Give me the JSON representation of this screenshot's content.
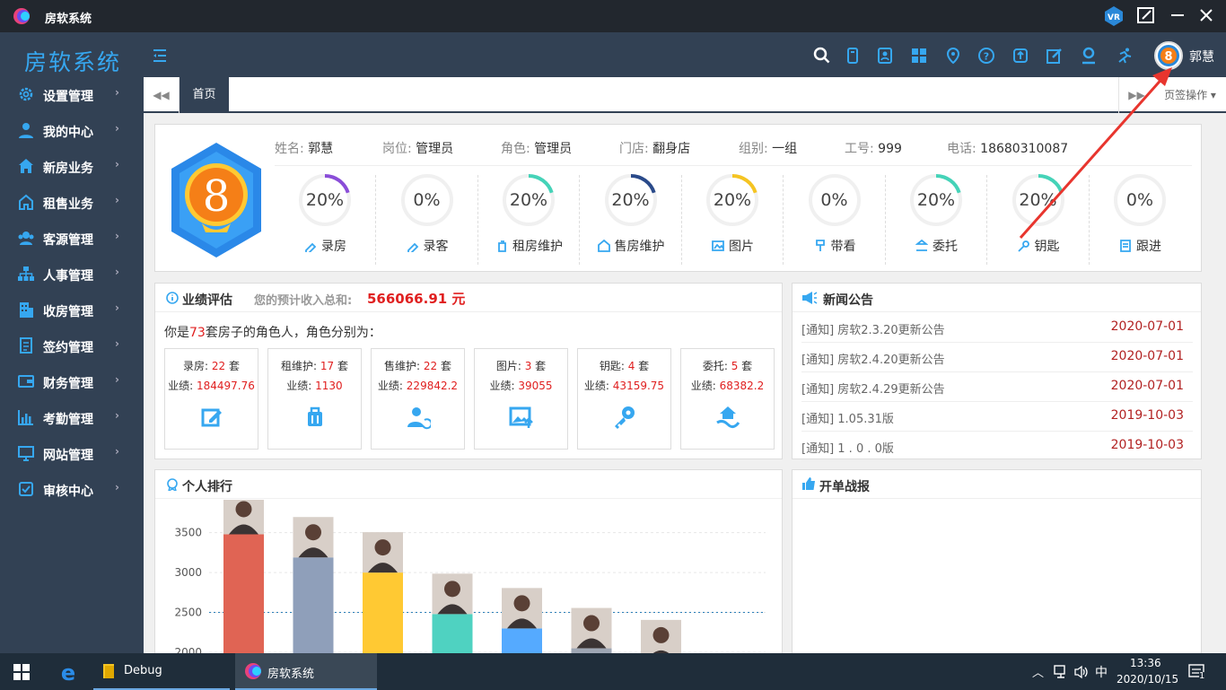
{
  "window": {
    "title": "房软系统"
  },
  "topbar": {
    "brand": "房软系统",
    "username": "郭慧",
    "avatar_digit": "8"
  },
  "sidebar": {
    "items": [
      {
        "label": "设置管理",
        "icon": "gear-icon"
      },
      {
        "label": "我的中心",
        "icon": "user-icon"
      },
      {
        "label": "新房业务",
        "icon": "house-icon"
      },
      {
        "label": "租售业务",
        "icon": "home-outline-icon"
      },
      {
        "label": "客源管理",
        "icon": "customers-icon"
      },
      {
        "label": "人事管理",
        "icon": "org-chart-icon"
      },
      {
        "label": "收房管理",
        "icon": "building-icon"
      },
      {
        "label": "签约管理",
        "icon": "contract-icon"
      },
      {
        "label": "财务管理",
        "icon": "wallet-icon"
      },
      {
        "label": "考勤管理",
        "icon": "bar-chart-icon"
      },
      {
        "label": "网站管理",
        "icon": "monitor-icon"
      },
      {
        "label": "审核中心",
        "icon": "check-icon"
      }
    ]
  },
  "tabs": {
    "home": "首页",
    "ops": "页签操作"
  },
  "profile": {
    "avatar_digit": "8",
    "fields": [
      {
        "key": "姓名:",
        "value": "郭慧"
      },
      {
        "key": "岗位:",
        "value": "管理员"
      },
      {
        "key": "角色:",
        "value": "管理员"
      },
      {
        "key": "门店:",
        "value": "翻身店"
      },
      {
        "key": "组别:",
        "value": "一组"
      },
      {
        "key": "工号:",
        "value": "999"
      },
      {
        "key": "电话:",
        "value": "18680310087"
      }
    ],
    "stats": [
      {
        "pct": "20%",
        "label": "录房",
        "fraction": 0.2,
        "color": "#8a4dd8"
      },
      {
        "pct": "0%",
        "label": "录客",
        "fraction": 0,
        "color": "#36a7f0"
      },
      {
        "pct": "20%",
        "label": "租房维护",
        "fraction": 0.2,
        "color": "#45d3b8"
      },
      {
        "pct": "20%",
        "label": "售房维护",
        "fraction": 0.2,
        "color": "#2a4a8a"
      },
      {
        "pct": "20%",
        "label": "图片",
        "fraction": 0.2,
        "color": "#f5c422"
      },
      {
        "pct": "0%",
        "label": "带看",
        "fraction": 0,
        "color": "#36a7f0"
      },
      {
        "pct": "20%",
        "label": "委托",
        "fraction": 0.2,
        "color": "#45d3b8"
      },
      {
        "pct": "20%",
        "label": "钥匙",
        "fraction": 0.2,
        "color": "#45d3b8"
      },
      {
        "pct": "0%",
        "label": "跟进",
        "fraction": 0,
        "color": "#36a7f0"
      }
    ]
  },
  "performance": {
    "title": "业绩评估",
    "income_label": "您的预计收入总和:",
    "income_value": "566066.91 元",
    "roles_prefix": "你是",
    "roles_count": "73",
    "roles_suffix": "套房子的角色人，角色分别为：",
    "cards": [
      {
        "role": "录房:",
        "count": "22",
        "unit": "套",
        "perf_label": "业绩:",
        "perf": "184497.76",
        "icon": "edit-icon"
      },
      {
        "role": "租维护:",
        "count": "17",
        "unit": "套",
        "perf_label": "业绩:",
        "perf": "1130",
        "icon": "suitcase-icon"
      },
      {
        "role": "售维护:",
        "count": "22",
        "unit": "套",
        "perf_label": "业绩:",
        "perf": "229842.2",
        "icon": "person-refresh-icon"
      },
      {
        "role": "图片:",
        "count": "3",
        "unit": "套",
        "perf_label": "业绩:",
        "perf": "39055",
        "icon": "image-upload-icon"
      },
      {
        "role": "钥匙:",
        "count": "4",
        "unit": "套",
        "perf_label": "业绩:",
        "perf": "43159.75",
        "icon": "key-icon"
      },
      {
        "role": "委托:",
        "count": "5",
        "unit": "套",
        "perf_label": "业绩:",
        "perf": "68382.2",
        "icon": "hand-house-icon"
      }
    ]
  },
  "news": {
    "title": "新闻公告",
    "items": [
      {
        "text": "[通知] 房软2.3.20更新公告",
        "date": "2020-07-01"
      },
      {
        "text": "[通知] 房软2.4.20更新公告",
        "date": "2020-07-01"
      },
      {
        "text": "[通知] 房软2.4.29更新公告",
        "date": "2020-07-01"
      },
      {
        "text": "[通知] 1.05.31版",
        "date": "2019-10-03"
      },
      {
        "text": "[通知] 1 . 0 . 0版",
        "date": "2019-10-03"
      }
    ]
  },
  "ranking": {
    "title": "个人排行"
  },
  "chart_data": {
    "type": "bar",
    "title": "个人排行",
    "ylim": [
      2000,
      3800
    ],
    "yticks": [
      2000,
      2500,
      3000,
      3500
    ],
    "ytick_labels": [
      "2000",
      "2500",
      "3000",
      "3500"
    ],
    "reference_line": 2500,
    "values": [
      3480,
      3190,
      3000,
      2480,
      2300,
      2050,
      1900
    ],
    "colors": [
      "#e06454",
      "#8f9fba",
      "#ffc933",
      "#4fd2c1",
      "#55aaff",
      "#9ea6b4",
      "#9ea6b4"
    ]
  },
  "report": {
    "title": "开单战报"
  },
  "taskbar": {
    "items": [
      {
        "label": "Debug"
      },
      {
        "label": "房软系统"
      }
    ],
    "time": "13:36",
    "date": "2020/10/15",
    "ime": "中",
    "notification_count": "1"
  }
}
